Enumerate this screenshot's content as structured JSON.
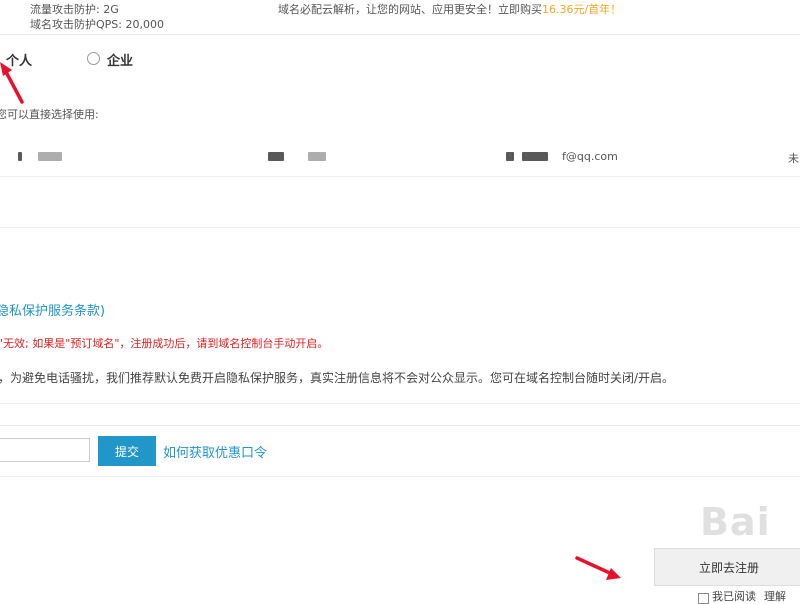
{
  "top_info": {
    "traffic_label": "流量攻击防护: ",
    "traffic_value": "2G",
    "qps_label": "域名攻击防护QPS: ",
    "qps_value": "20,000",
    "promo_text": "域名必配云解析，让您的网站、应用更安全！立即购买",
    "promo_price": "16.36元/首年！"
  },
  "owner_type": {
    "personal_label": "个人",
    "enterprise_label": "企业"
  },
  "template_hint": "您可以直接选择使用:",
  "contact_row": {
    "email_suffix": "@qq.com",
    "trailing_text": "未"
  },
  "privacy": {
    "terms_link": "隐私保护服务条款)",
    "warning": "\"无效; 如果是\"预订域名\"，注册成功后，请到域名控制台手动开启。",
    "notice": "，为避免电话骚扰，我们推荐默认免费开启隐私保护服务，真实注册信息将不会对公众显示。您可在域名控制台随时关闭/开启。"
  },
  "coupon": {
    "input_value": "",
    "submit_label": "提交",
    "help_link": "如何获取优惠口令"
  },
  "footer": {
    "register_button": "立即去注册",
    "agree_text": "我已阅读",
    "agree_link": "理解"
  },
  "watermark_text": "Bai",
  "colors": {
    "accent_blue": "#2196c9",
    "promo_orange": "#f5a623",
    "warning_red": "#e02020",
    "annotation_red": "#e8112d"
  }
}
